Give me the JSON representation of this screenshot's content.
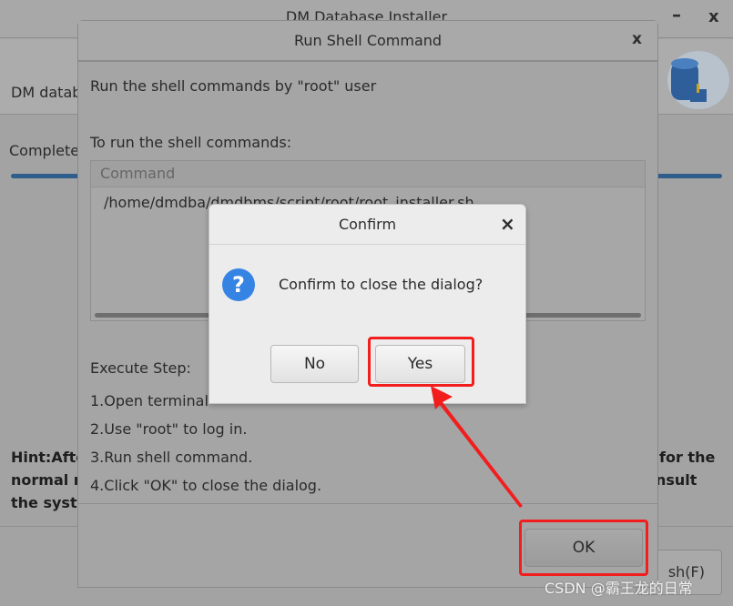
{
  "installer": {
    "title": "DM Database Installer",
    "minimize": "–",
    "close": "x",
    "header_text": "DM datab",
    "status_text": "Complete",
    "progress_percent": 100,
    "hint_lines": [
      "Hint:Afte",
      "normal r",
      "the syste"
    ],
    "hint_right": [
      "for the",
      "nsult"
    ],
    "finish_label": "sh(F)"
  },
  "shell_dialog": {
    "title": "Run Shell Command",
    "close": "x",
    "intro": "Run the shell commands by \"root\" user",
    "to_run": "To run the shell commands:",
    "table": {
      "header": "Command",
      "rows": [
        "/home/dmdba/dmdbms/script/root/root_installer.sh"
      ]
    },
    "steps_title": "Execute Step:",
    "steps": [
      "1.Open terminal",
      "2.Use \"root\" to log in.",
      "3.Run shell command.",
      "4.Click \"OK\" to close the dialog."
    ],
    "ok_label": "OK"
  },
  "confirm_dialog": {
    "title": "Confirm",
    "close": "×",
    "icon": "question-icon",
    "message": "Confirm to close the dialog?",
    "no_label": "No",
    "yes_label": "Yes"
  },
  "annotation": {
    "highlight_color": "#f21d1d"
  },
  "watermark": "CSDN @霸王龙的日常"
}
